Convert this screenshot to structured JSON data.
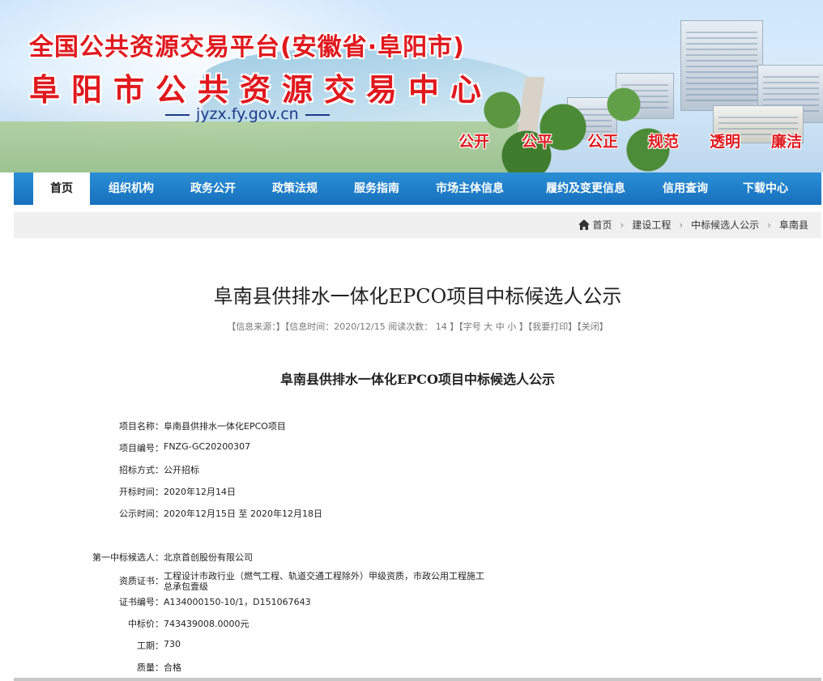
{
  "banner": {
    "title_line1": "全国公共资源交易平台(安徽省·阜阳市)",
    "title_line2": "阜阳市公共资源交易中心",
    "url": "jyzx.fy.gov.cn",
    "slogans": [
      "公开",
      "公平",
      "公正",
      "规范",
      "透明",
      "廉洁"
    ]
  },
  "nav": {
    "items": [
      "首页",
      "组织机构",
      "政务公开",
      "政策法规",
      "服务指南",
      "市场主体信息",
      "履约及变更信息",
      "信用查询",
      "下载中心"
    ],
    "active_index": 0
  },
  "breadcrumb": [
    "首页",
    "建设工程",
    "中标候选人公示",
    "阜南县"
  ],
  "article": {
    "title": "阜南县供排水一体化EPCO项目中标候选人公示",
    "meta": {
      "source_label": "【信息来源：",
      "time_label": "】【信息时间：",
      "time": "2020/12/15",
      "views_label": "阅读次数：",
      "views": "14",
      "font_label": "】【字号",
      "font_large": "大",
      "font_medium": "中",
      "font_small": "小",
      "print": "】【我要打印",
      "close": "】【关闭】"
    },
    "subtitle": "阜南县供排水一体化EPCO项目中标候选人公示",
    "fields": [
      {
        "label": "项目名称：",
        "value": "阜南县供排水一体化EPCO项目"
      },
      {
        "label": "项目编号：",
        "value": "FNZG-GC20200307"
      },
      {
        "label": "招标方式：",
        "value": "公开招标"
      },
      {
        "label": "开标时间：",
        "value": "2020年12月14日"
      },
      {
        "label": "公示时间：",
        "value": "2020年12月15日 至 2020年12月18日"
      }
    ],
    "candidate": [
      {
        "label": "第一中标候选人：",
        "value": "北京首创股份有限公司"
      },
      {
        "label": "资质证书：",
        "value": "工程设计市政行业（燃气工程、轨道交通工程除外）甲级资质，市政公用工程施工",
        "value2": "总承包壹级"
      },
      {
        "label": "证书编号：",
        "value": "A134000150-10/1，D151067643"
      },
      {
        "label": "中标价：",
        "value": "743439008.0000元"
      },
      {
        "label": "工期：",
        "value": "730"
      },
      {
        "label": "质量：",
        "value": "合格"
      }
    ]
  },
  "colors": {
    "nav_bg": "#1770bd",
    "banner_title": "#e0191e",
    "url_text": "#1b3b8c"
  }
}
